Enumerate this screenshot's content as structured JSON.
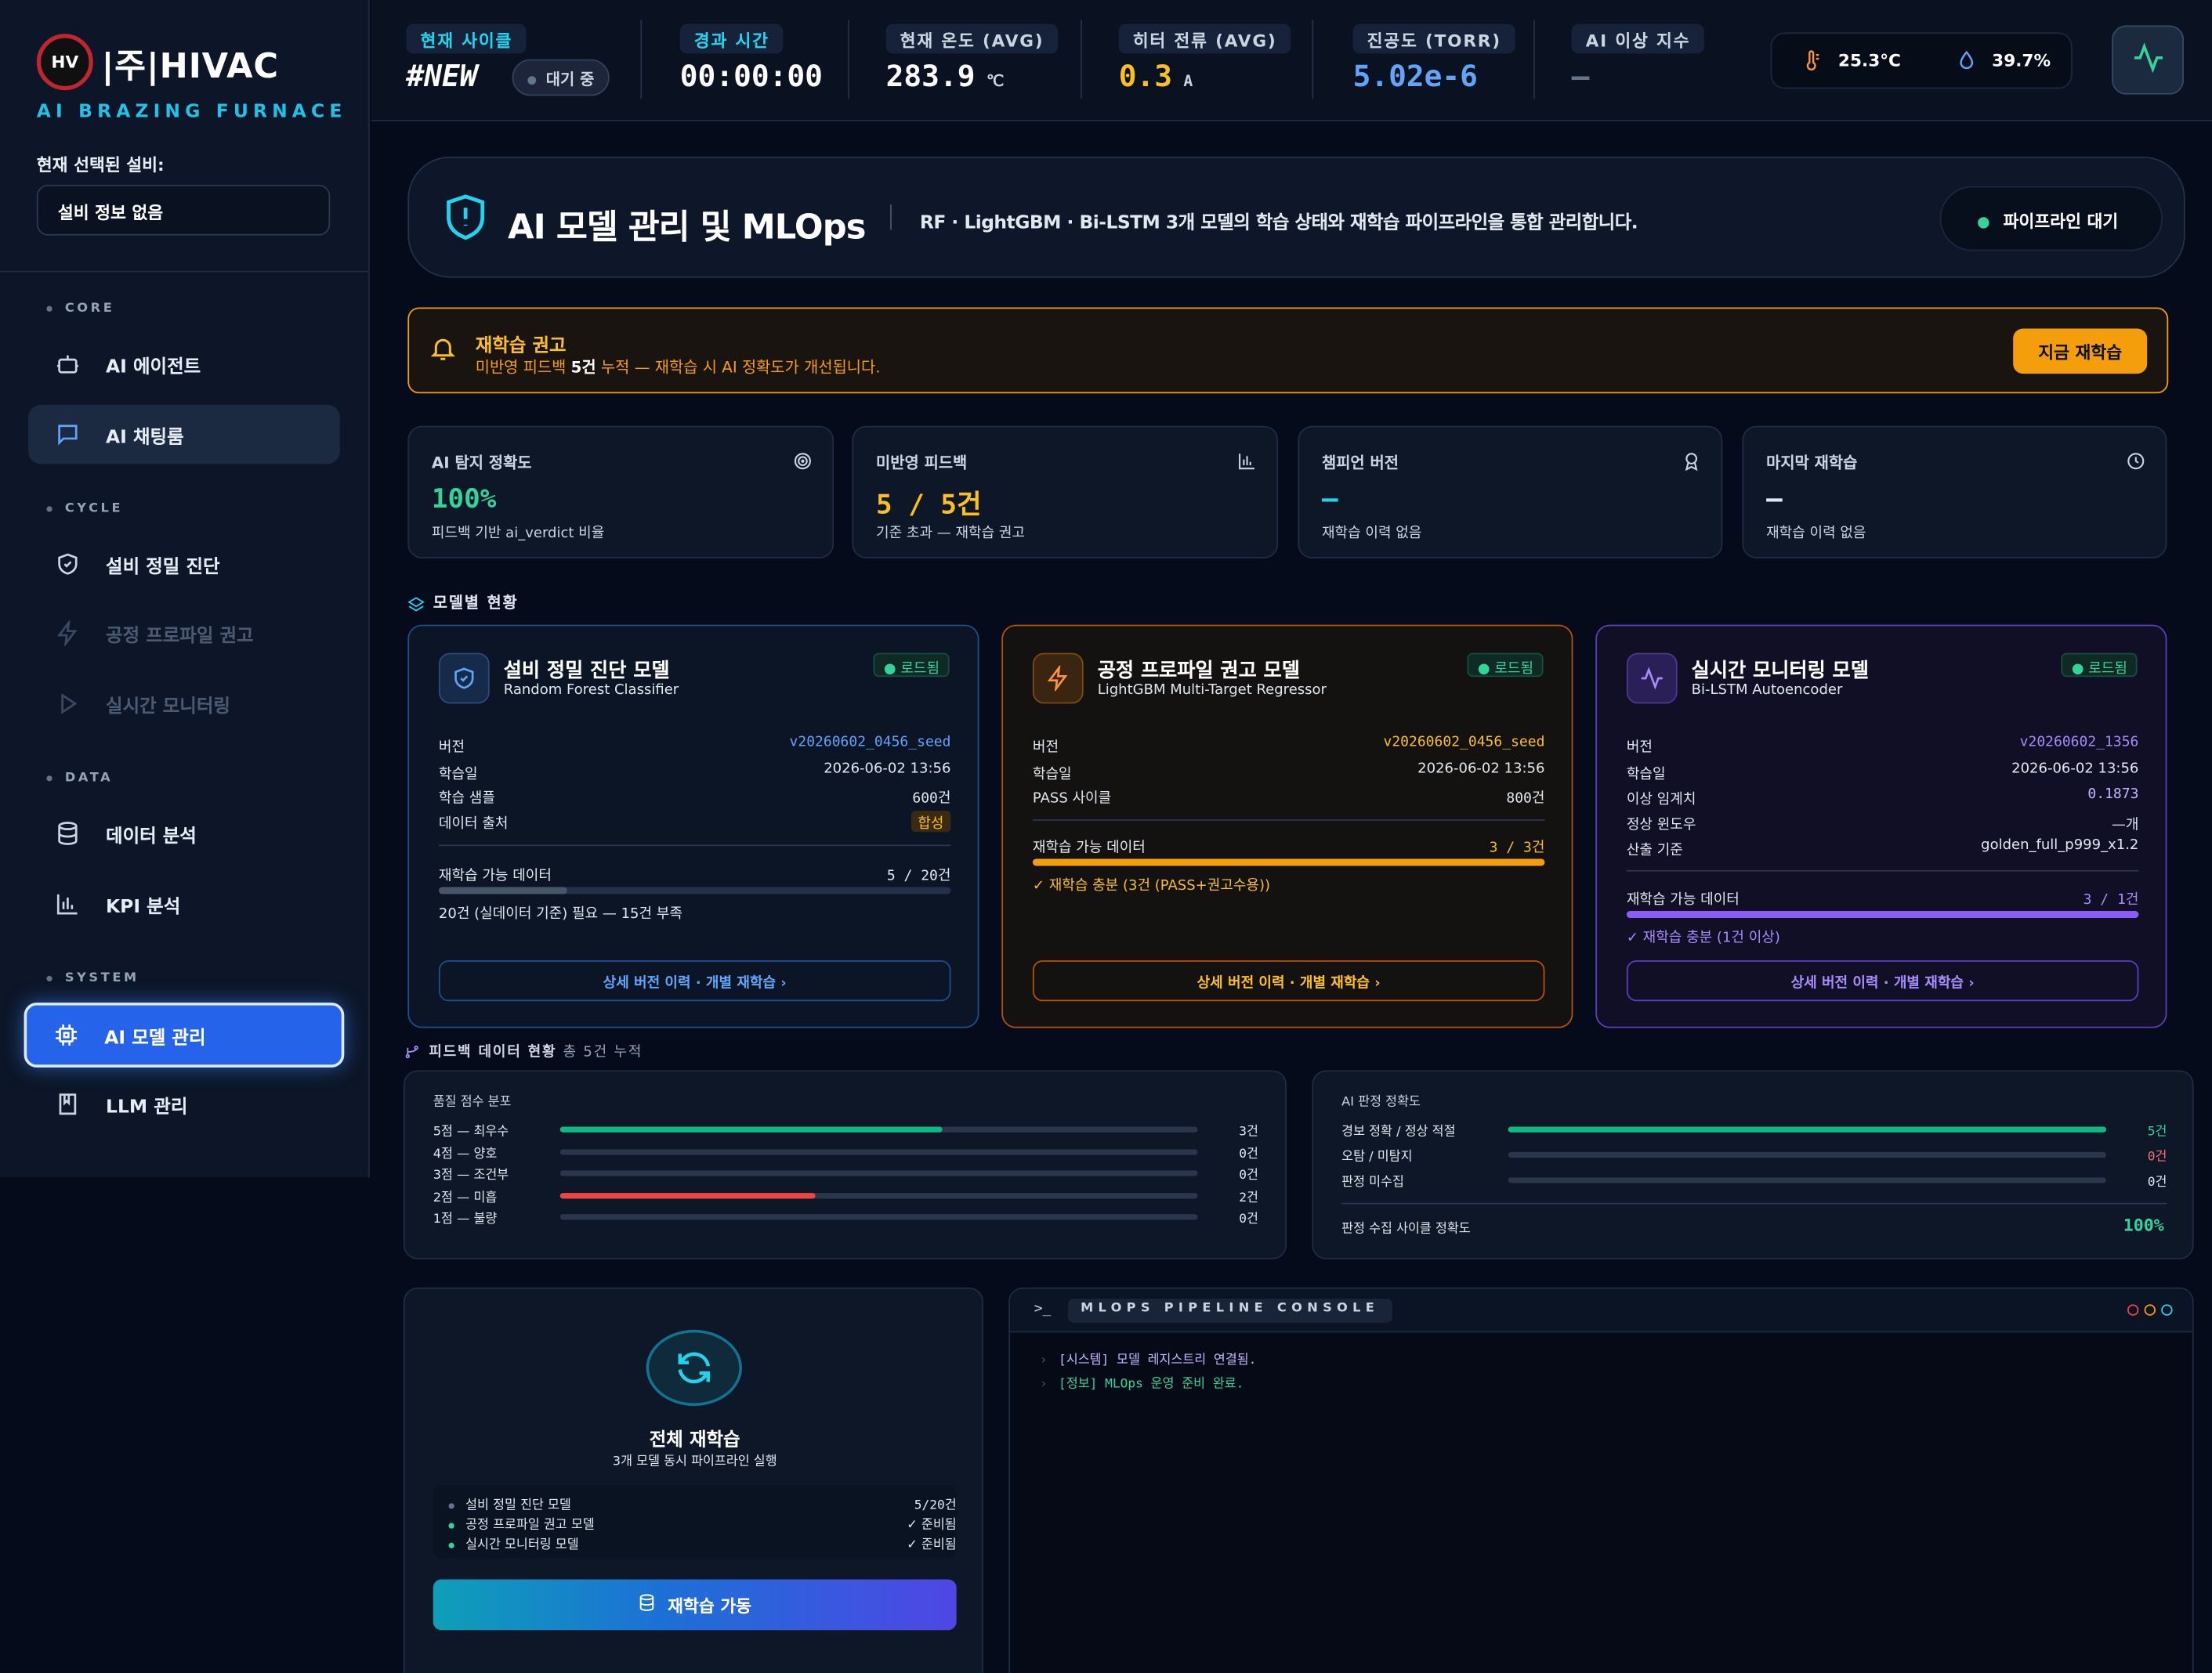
{
  "sidebar": {
    "logo_mark": "HV",
    "brand": "|주|HIVAC",
    "subtitle": "AI BRAZING FURNACE",
    "selected_label": "현재 선택된 설비:",
    "selected_value": "설비 정보 없음",
    "sections": {
      "core": "CORE",
      "cycle": "CYCLE",
      "data": "DATA",
      "system": "SYSTEM"
    },
    "items": [
      {
        "label": "AI 에이전트",
        "icon": "robot-icon"
      },
      {
        "label": "AI 채팅룸",
        "icon": "chat-icon"
      },
      {
        "label": "설비 정밀 진단",
        "icon": "shield-check-icon"
      },
      {
        "label": "공정 프로파일 권고",
        "icon": "bolt-icon",
        "disabled": true
      },
      {
        "label": "실시간 모니터링",
        "icon": "play-icon",
        "disabled": true
      },
      {
        "label": "데이터 분석",
        "icon": "database-icon"
      },
      {
        "label": "KPI 분석",
        "icon": "bar-chart-icon"
      },
      {
        "label": "AI 모델 관리",
        "icon": "cpu-icon",
        "active": true
      },
      {
        "label": "LLM 관리",
        "icon": "book-icon"
      }
    ]
  },
  "header": {
    "cycle_label": "현재 사이클",
    "cycle_value": "#NEW",
    "cycle_status": "대기 중",
    "elapsed_label": "경과 시간",
    "elapsed_value": "00:00:00",
    "temp_label": "현재 온도 (AVG)",
    "temp_value": "283.9",
    "temp_unit": "℃",
    "current_label": "히터 전류 (AVG)",
    "current_value": "0.3",
    "current_unit": "A",
    "vacuum_label": "진공도 (TORR)",
    "vacuum_value": "5.02e-6",
    "anomaly_label": "AI 이상 지수",
    "anomaly_value": "—",
    "weather_temp": "25.3°C",
    "weather_humidity": "39.7%"
  },
  "banner": {
    "title": "AI 모델 관리 및 MLOps",
    "description": "RF · LightGBM · Bi-LSTM 3개 모델의 학습 상태와 재학습 파이프라인을 통합 관리합니다.",
    "status": "파이프라인 대기"
  },
  "alert": {
    "title": "재학습 권고",
    "msg_pre": "미반영 피드백 ",
    "msg_count": "5건",
    "msg_post": " 누적 — 재학습 시 AI 정확도가 개선됩니다.",
    "button": "지금 재학습"
  },
  "stats": [
    {
      "label": "AI 탐지 정확도",
      "value": "100%",
      "sub": "피드백 기반 ai_verdict 비율",
      "icon": "target-icon",
      "color": "#34d399"
    },
    {
      "label": "미반영 피드백",
      "value": "5 / 5건",
      "sub": "기준 초과 — 재학습 권고",
      "icon": "bar-chart-icon",
      "color": "#fbbf24"
    },
    {
      "label": "챔피언 버전",
      "value": "—",
      "sub": "재학습 이력 없음",
      "icon": "award-icon",
      "color": "#22d3ee"
    },
    {
      "label": "마지막 재학습",
      "value": "—",
      "sub": "재학습 이력 없음",
      "icon": "clock-icon",
      "color": "#e2e8f0"
    }
  ],
  "models_title": "모델별 현황",
  "models": [
    {
      "title": "설비 정밀 진단 모델",
      "subtitle": "Random Forest Classifier",
      "badge": "● 로드됨",
      "rows": [
        [
          "버전",
          "v20260602_0456_seed"
        ],
        [
          "학습일",
          "2026-06-02 13:56"
        ],
        [
          "학습 샘플",
          "600건"
        ],
        [
          "데이터 출처",
          "합성"
        ]
      ],
      "retrain_label": "재학습 가능 데이터",
      "retrain_value": "5 / 20건",
      "progress": 0.25,
      "note": "20건 (실데이터 기준) 필요 — 15건 부족",
      "link": "상세 버전 이력 · 개별 재학습  ›"
    },
    {
      "title": "공정 프로파일 권고 모델",
      "subtitle": "LightGBM Multi-Target Regressor",
      "badge": "● 로드됨",
      "rows": [
        [
          "버전",
          "v20260602_0456_seed"
        ],
        [
          "학습일",
          "2026-06-02 13:56"
        ],
        [
          "PASS 사이클",
          "800건"
        ]
      ],
      "retrain_label": "재학습 가능 데이터",
      "retrain_value": "3 / 3건",
      "progress": 1.0,
      "note": "✓ 재학습 충분 (3건 (PASS+권고수용))",
      "link": "상세 버전 이력 · 개별 재학습  ›"
    },
    {
      "title": "실시간 모니터링 모델",
      "subtitle": "Bi-LSTM Autoencoder",
      "badge": "● 로드됨",
      "rows": [
        [
          "버전",
          "v20260602_1356"
        ],
        [
          "학습일",
          "2026-06-02 13:56"
        ],
        [
          "이상 임계치",
          "0.1873"
        ],
        [
          "정상 윈도우",
          "—개"
        ],
        [
          "산출 기준",
          "golden_full_p999_x1.2"
        ]
      ],
      "retrain_label": "재학습 가능 데이터",
      "retrain_value": "3 / 1건",
      "progress": 1.0,
      "note": "✓ 재학습 충분 (1건 이상)",
      "link": "상세 버전 이력 · 개별 재학습  ›"
    }
  ],
  "feedback": {
    "title": "피드백 데이터 현황",
    "total": "총 5건 누적",
    "score_title": "품질 점수 분포",
    "scores": [
      {
        "label": "5점 — 최우수",
        "count": "3건",
        "ratio": 0.6,
        "color": "#10b981"
      },
      {
        "label": "4점 — 양호",
        "count": "0건",
        "ratio": 0,
        "color": "#10b981"
      },
      {
        "label": "3점 — 조건부",
        "count": "0건",
        "ratio": 0,
        "color": "#10b981"
      },
      {
        "label": "2점 — 미흡",
        "count": "2건",
        "ratio": 0.4,
        "color": "#ef4444"
      },
      {
        "label": "1점 — 불량",
        "count": "0건",
        "ratio": 0,
        "color": "#ef4444"
      }
    ],
    "acc_title": "AI 판정 정확도",
    "acc": [
      {
        "label": "경보 정확 / 정상 적절",
        "count": "5건",
        "ratio": 1.0,
        "color": "#10b981",
        "count_color": "#34d399"
      },
      {
        "label": "오탐 / 미탐지",
        "count": "0건",
        "ratio": 0,
        "color": "#ef4444",
        "count_color": "#f87171"
      },
      {
        "label": "판정 미수집",
        "count": "0건",
        "ratio": 0,
        "color": "#64748b",
        "count_color": "#e2e8f0"
      }
    ],
    "acc_footer_label": "판정 수집 사이클 정확도",
    "acc_footer_value": "100%"
  },
  "retrain_all": {
    "title": "전체 재학습",
    "subtitle": "3개 모델 동시 파이프라인 실행",
    "items": [
      {
        "label": "설비 정밀 진단 모델",
        "status": "5/20건",
        "dot": "#64748b"
      },
      {
        "label": "공정 프로파일 권고 모델",
        "status": "✓ 준비됨",
        "dot": "#34d399"
      },
      {
        "label": "실시간 모니터링 모델",
        "status": "✓ 준비됨",
        "dot": "#34d399"
      }
    ],
    "button": "재학습 가동"
  },
  "console": {
    "prompt": ">_",
    "title": "MLOPS PIPELINE CONSOLE",
    "lines": [
      {
        "text": "[시스템] 모델 레지스트리 연결됨.",
        "color": "#c4b5fd"
      },
      {
        "text": "[정보] MLOps 운영 준비 완료.",
        "color": "#34d399"
      }
    ]
  },
  "colors": {
    "accent": "#2563eb",
    "cyan": "#22d3ee",
    "amber": "#f59e0b",
    "purple": "#8b5cf6",
    "green": "#34d399",
    "red": "#ef4444"
  }
}
